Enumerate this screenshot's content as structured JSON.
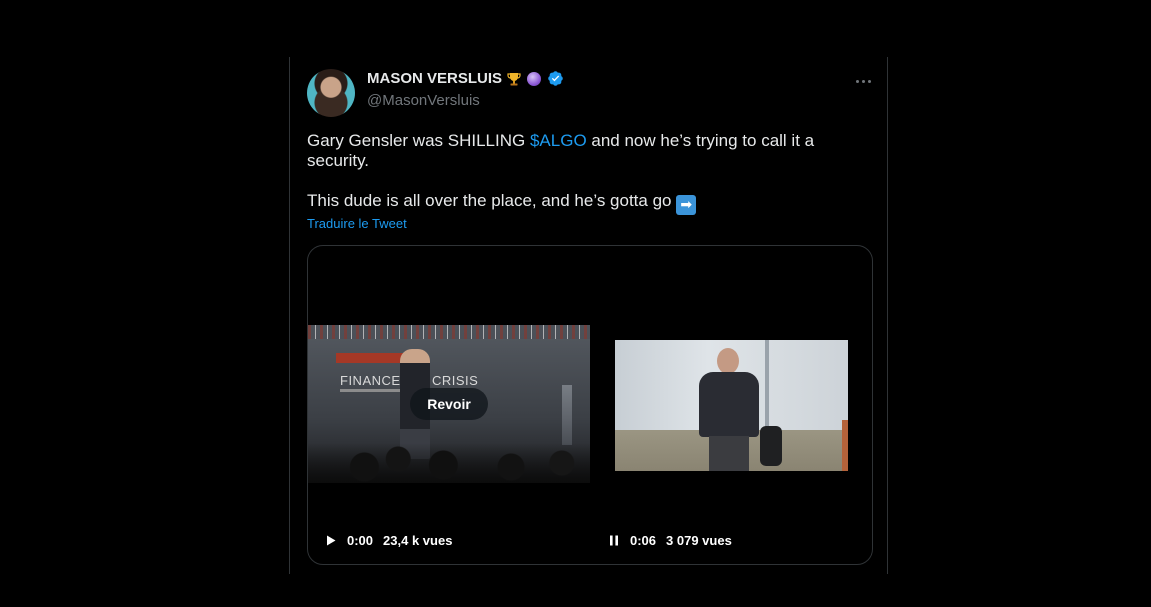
{
  "tweet": {
    "display_name": "MASON VERSLUIS",
    "name_emojis": [
      "trophy-emoji",
      "crystal-ball-emoji"
    ],
    "handle": "@MasonVersluis",
    "text_line1_before": "Gary Gensler was SHILLING ",
    "cashtag": "$ALGO",
    "text_line1_after": " and now he’s trying to call it a security.",
    "text_line2": "This dude is all over the place, and he’s gotta go ",
    "arrow_emoji": "➡",
    "translate_link": "Traduire le Tweet"
  },
  "media": {
    "video1": {
      "replay_label": "Revoir",
      "slide_title": "FINANCE B        D CRISIS",
      "time": "0:00",
      "views": "23,4 k vues",
      "control_icon": "play-icon"
    },
    "video2": {
      "time": "0:06",
      "views": "3 079 vues",
      "control_icon": "pause-icon"
    }
  },
  "colors": {
    "background": "#000000",
    "text": "#e7e9ea",
    "secondary_text": "#71767b",
    "accent": "#1d9bf0",
    "border": "#2f3336",
    "verified": "#1d9bf0"
  }
}
